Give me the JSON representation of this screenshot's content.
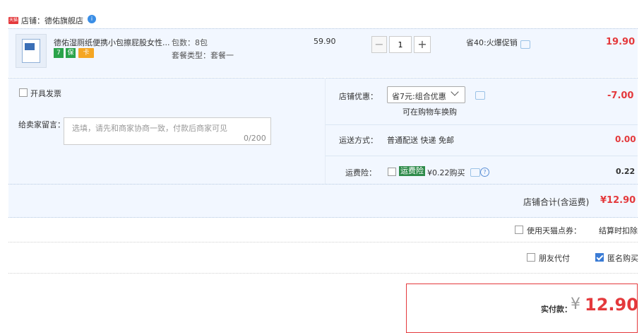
{
  "shop": {
    "tag": "天猫",
    "label": "店铺：德佑旗舰店",
    "ww_icon": "chat-bubble-icon"
  },
  "item": {
    "title": "德佑湿厕纸便携小包擦屁股女性...",
    "badges": [
      "7",
      "保",
      "卡"
    ],
    "spec_count": "包数：8包",
    "spec_type": "套餐类型：套餐一",
    "unit_price": "59.90",
    "qty": "1",
    "qty_minus": "−",
    "qty_plus": "+",
    "promo": "省40:火爆促销",
    "subtotal": "19.90"
  },
  "options": {
    "invoice_label": "开具发票",
    "message_label": "给卖家留言：",
    "message_placeholder": "选填，请先和商家协商一致，付款后商家可见",
    "message_count": "0/200",
    "coupon_label": "店铺优惠：",
    "coupon_selected": "省7元:组合优惠",
    "coupon_sub": "可在购物车换购",
    "coupon_amount": "-7.00",
    "shipping_label": "运送方式：",
    "shipping_value": "普通配送 快递 免邮",
    "shipping_amount": "0.00",
    "insurance_label": "运费险：",
    "insurance_tag": "运费险",
    "insurance_text": "¥0.22购买",
    "insurance_amount": "0.22",
    "help_glyph": "?"
  },
  "total": {
    "label": "店铺合计(含运费)",
    "value": "¥12.90"
  },
  "extras": {
    "tmall_points_label": "使用天猫点券：",
    "tmall_points_value": "结算时扣除",
    "friend_pay_label": "朋友代付",
    "anonymous_label": "匿名购买",
    "anonymous_checked": true
  },
  "payment": {
    "label": "实付款：",
    "yen": "¥",
    "value": "12.90"
  },
  "colors": {
    "accent_red": "#e4393c",
    "row_bg": "#f2f7ff",
    "insurance_green": "#2e8b4a",
    "check_blue": "#3a7bd5"
  }
}
